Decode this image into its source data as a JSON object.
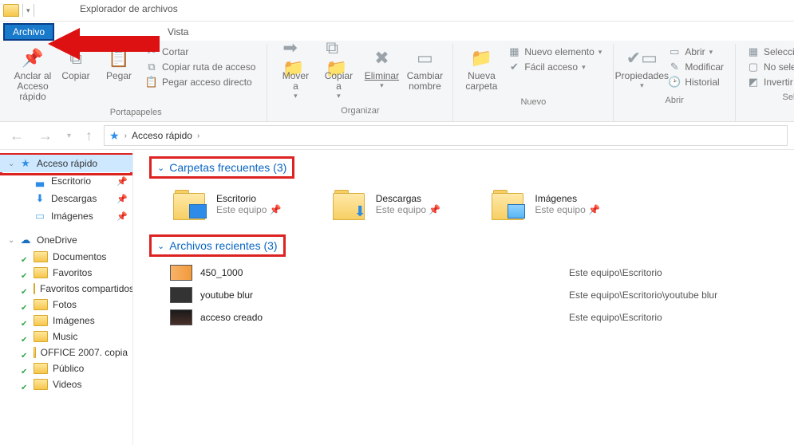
{
  "window": {
    "title": "Explorador de archivos"
  },
  "tabs": {
    "file": "Archivo",
    "vista": "Vista"
  },
  "ribbon": {
    "pin": {
      "label1": "Anclar al",
      "label2": "Acceso rápido"
    },
    "copy": "Copiar",
    "paste": "Pegar",
    "cut": "Cortar",
    "copy_path": "Copiar ruta de acceso",
    "paste_shortcut": "Pegar acceso directo",
    "group_clipboard": "Portapapeles",
    "move_to": {
      "l1": "Mover",
      "l2": "a"
    },
    "copy_to": {
      "l1": "Copiar",
      "l2": "a"
    },
    "delete": "Eliminar",
    "rename": {
      "l1": "Cambiar",
      "l2": "nombre"
    },
    "group_organize": "Organizar",
    "new_folder": {
      "l1": "Nueva",
      "l2": "carpeta"
    },
    "new_item": "Nuevo elemento",
    "easy_access": "Fácil acceso",
    "group_new": "Nuevo",
    "properties": "Propiedades",
    "open": "Abrir",
    "modify": "Modificar",
    "history": "Historial",
    "group_open": "Abrir",
    "select_all": "Seleccionar todo",
    "select_none": "No seleccionar ninguno",
    "invert": "Invertir selección",
    "group_select": "Seleccionar"
  },
  "breadcrumb": {
    "root": "Acceso rápido"
  },
  "nav": {
    "quick": "Acceso rápido",
    "desktop": "Escritorio",
    "downloads": "Descargas",
    "images": "Imágenes",
    "onedrive": "OneDrive",
    "documents": "Documentos",
    "favorites": "Favoritos",
    "favorites_shared": "Favoritos compartidos",
    "photos": "Fotos",
    "images2": "Imágenes",
    "music": "Music",
    "office": "OFFICE 2007. copia",
    "public": "Público",
    "videos": "Videos"
  },
  "sections": {
    "frequent": "Carpetas frecuentes (3)",
    "recent": "Archivos recientes (3)"
  },
  "frequent_folders": [
    {
      "name": "Escritorio",
      "sub": "Este equipo",
      "kind": "desktop"
    },
    {
      "name": "Descargas",
      "sub": "Este equipo",
      "kind": "downloads"
    },
    {
      "name": "Imágenes",
      "sub": "Este equipo",
      "kind": "images"
    }
  ],
  "recent_files": [
    {
      "name": "450_1000",
      "path": "Este equipo\\Escritorio",
      "kind": "a"
    },
    {
      "name": "youtube blur",
      "path": "Este equipo\\Escritorio\\youtube blur",
      "kind": "b"
    },
    {
      "name": "acceso creado",
      "path": "Este equipo\\Escritorio",
      "kind": "c"
    }
  ]
}
